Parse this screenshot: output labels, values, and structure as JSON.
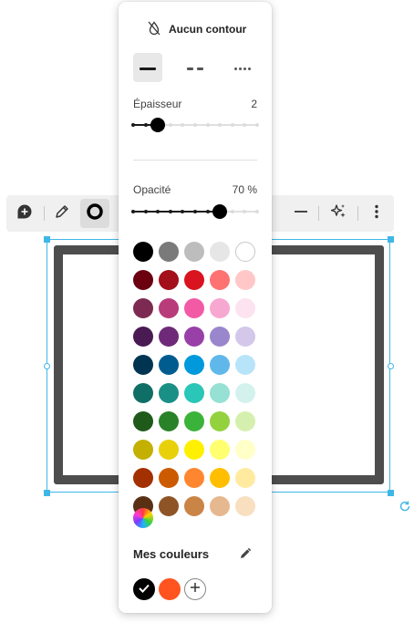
{
  "panel": {
    "no_outline_label": "Aucun contour",
    "thickness": {
      "label": "Épaisseur",
      "value": "2",
      "level": 0.2
    },
    "opacity": {
      "label": "Opacité",
      "value": "70 %",
      "level": 0.7
    },
    "my_colors_label": "Mes couleurs",
    "palette": [
      [
        "#000000",
        "#7a7a7a",
        "#bdbdbd",
        "#e6e6e6",
        "#ffffff"
      ],
      [
        "#6b0010",
        "#a30f1a",
        "#d9131f",
        "#ff7272",
        "#ffc7c7"
      ],
      [
        "#7d2a52",
        "#b83b7a",
        "#f25aa6",
        "#f7a8d1",
        "#fce3ef"
      ],
      [
        "#4a1a52",
        "#6e2a78",
        "#9840a8",
        "#9a86cc",
        "#d3c7ea"
      ],
      [
        "#003552",
        "#005c8f",
        "#0099dc",
        "#60b8ea",
        "#b8e4fa"
      ],
      [
        "#0f6f66",
        "#1a8f85",
        "#2ac6b8",
        "#96e0d4",
        "#d3f2ee"
      ],
      [
        "#1f5a1a",
        "#2a8228",
        "#3bb33a",
        "#93d23e",
        "#d5f0ae"
      ],
      [
        "#c3b000",
        "#e8d10a",
        "#fff000",
        "#ffff70",
        "#ffffc8"
      ],
      [
        "#a33000",
        "#cc5a00",
        "#ff8630",
        "#ffbf00",
        "#ffeaa0"
      ],
      [
        "#5a3015",
        "#8f5426",
        "#c98446",
        "#e6b890",
        "#f7dfc0"
      ]
    ],
    "my_colors": [
      "#000000",
      "#ff5420"
    ]
  },
  "toolbar": {
    "icons": [
      "add-comment-icon",
      "pencil-icon",
      "outline-ring-icon",
      "line-style-icon",
      "sparkle-icon",
      "more-vertical-icon"
    ]
  },
  "colors": {
    "selection": "#3fb7e6",
    "shape_stroke": "#4d4d4d"
  }
}
